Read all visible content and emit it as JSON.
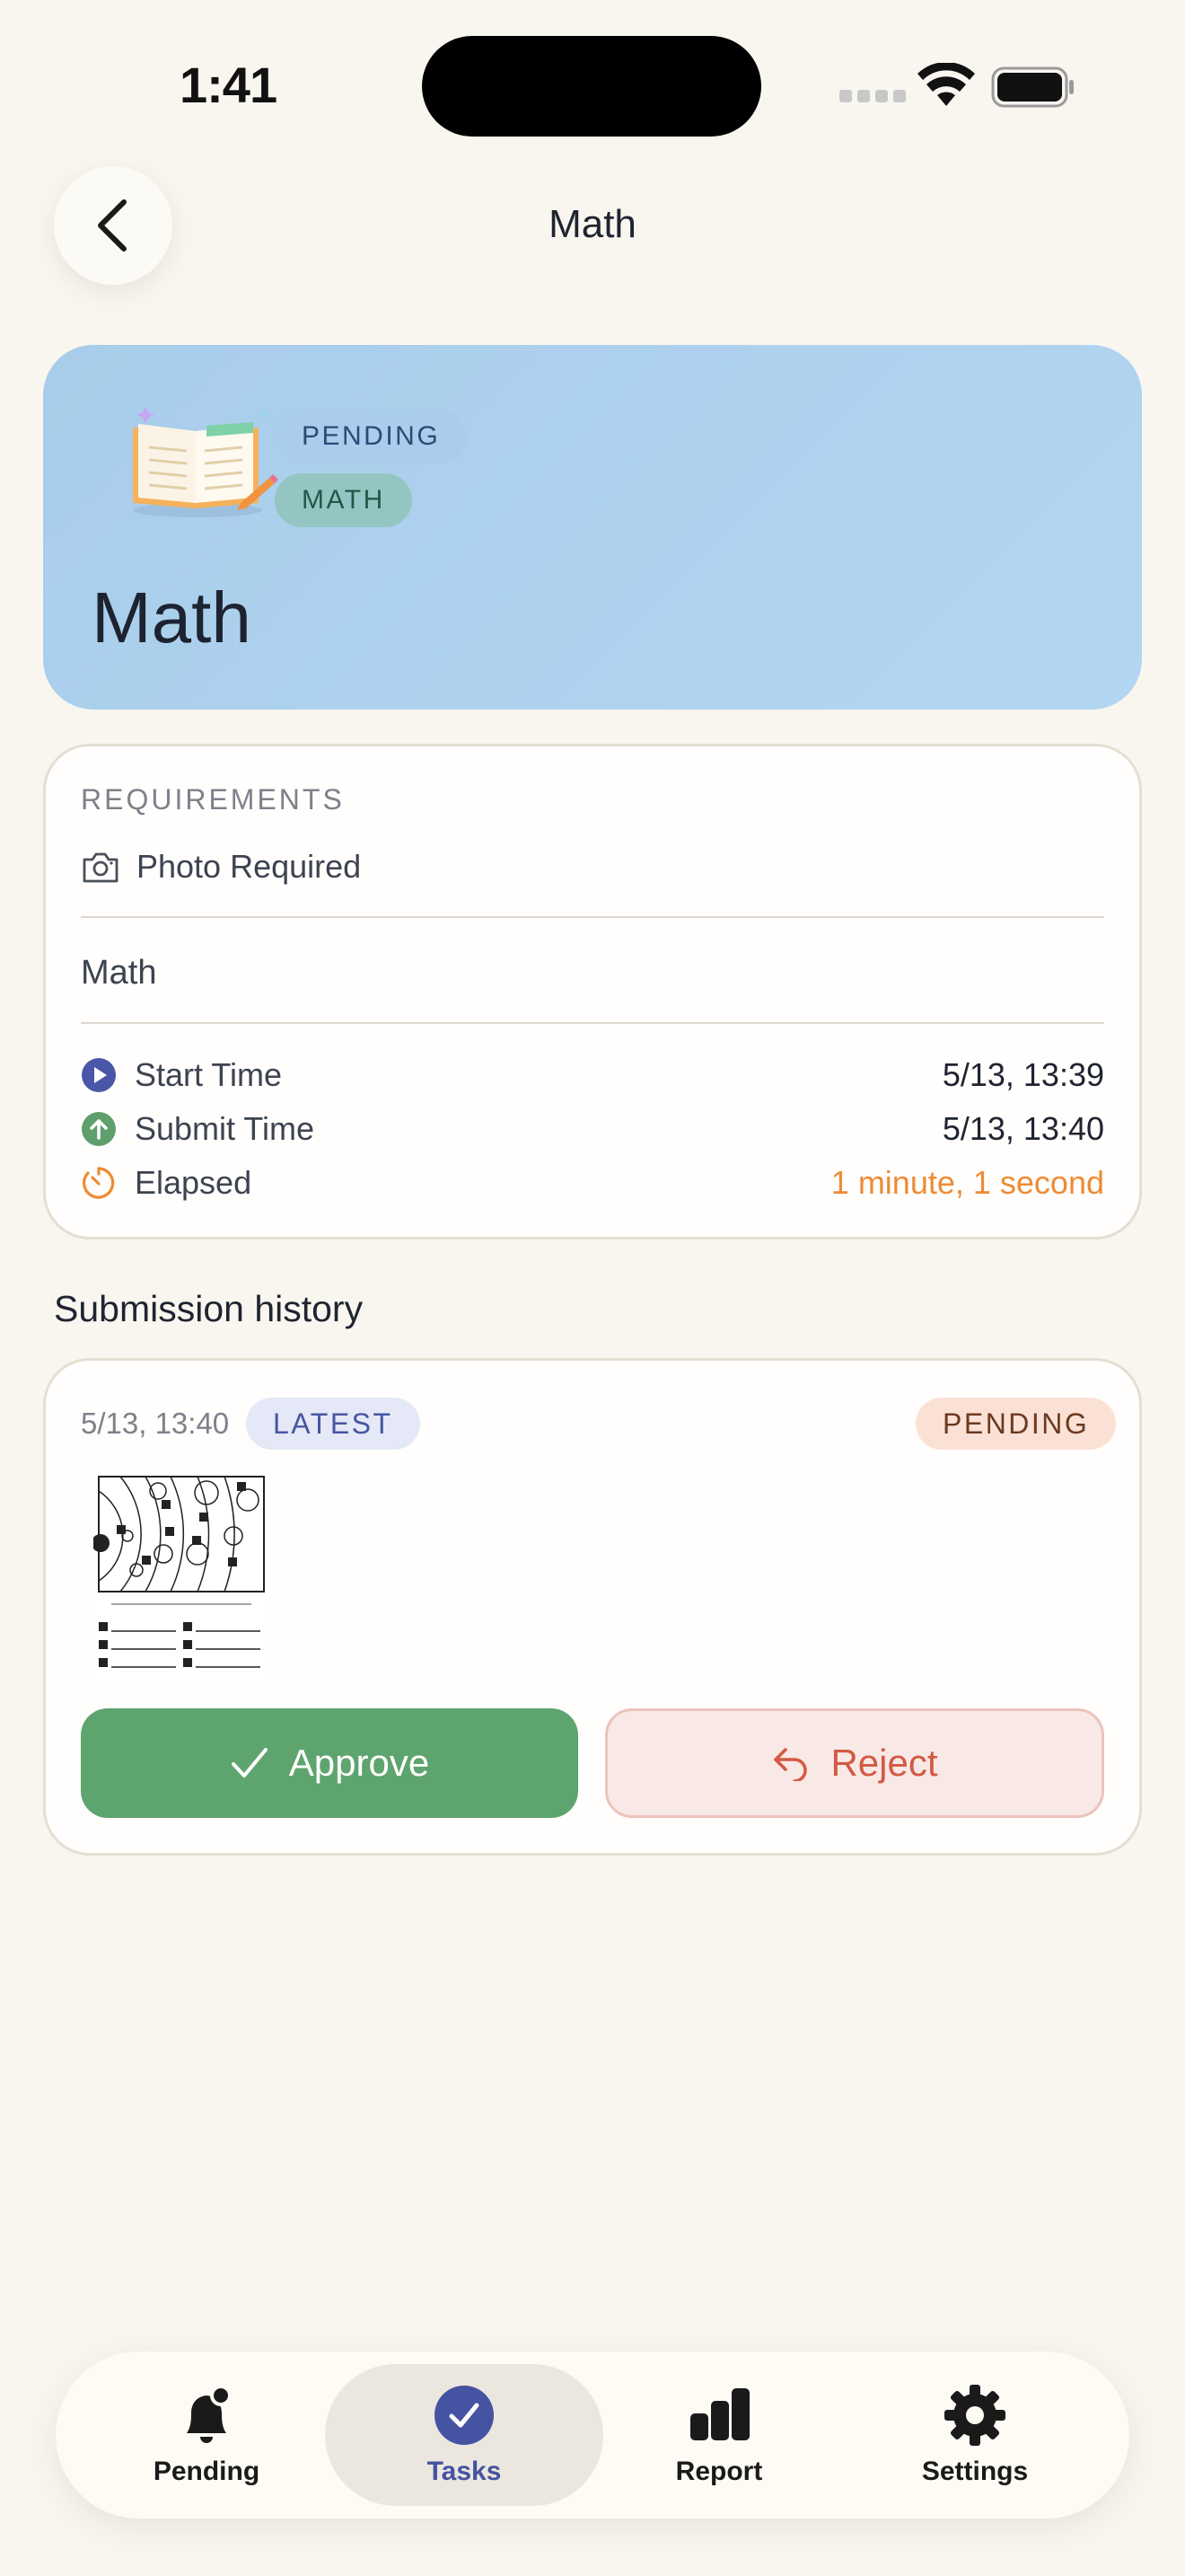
{
  "status_bar": {
    "time": "1:41"
  },
  "header": {
    "title": "Math"
  },
  "hero": {
    "status_pill": "PENDING",
    "subject_pill": "MATH",
    "title": "Math"
  },
  "requirements": {
    "heading": "REQUIREMENTS",
    "photo_required": "Photo Required",
    "description": "Math",
    "times": [
      {
        "label": "Start Time",
        "value": "5/13, 13:39"
      },
      {
        "label": "Submit Time",
        "value": "5/13, 13:40"
      },
      {
        "label": "Elapsed",
        "value": "1 minute, 1 second"
      }
    ]
  },
  "submission_history": {
    "title": "Submission history",
    "entry": {
      "date": "5/13, 13:40",
      "latest_badge": "LATEST",
      "status": "PENDING",
      "approve_label": "Approve",
      "reject_label": "Reject"
    }
  },
  "tab_bar": {
    "tabs": [
      {
        "label": "Pending"
      },
      {
        "label": "Tasks"
      },
      {
        "label": "Report"
      },
      {
        "label": "Settings"
      }
    ],
    "active_index": 1
  },
  "colors": {
    "accent": "#4652a2",
    "approve": "#5ea46e",
    "reject": "#d35a44",
    "elapsed": "#ee8b35"
  }
}
